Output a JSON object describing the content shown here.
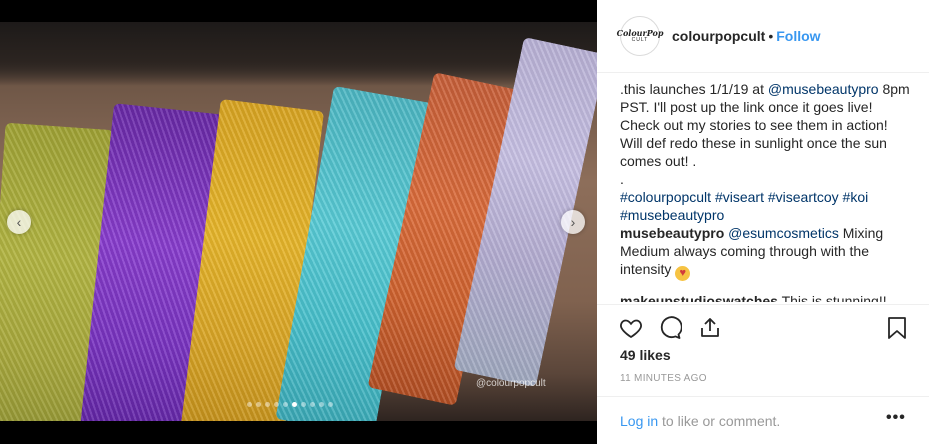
{
  "media": {
    "watermark": "@colourpopcult",
    "nav_prev": "‹",
    "nav_next": "›",
    "dots_total": 10,
    "active_dot": 5
  },
  "header": {
    "avatar_text_top": "ColourPop",
    "avatar_text_bottom": "CULT",
    "username": "colourpopcult",
    "separator": "•",
    "follow_label": "Follow"
  },
  "caption": {
    "text_before_mention": ".this launches 1/1/19 at ",
    "mention": "@musebeautypro",
    "text_after_mention": " 8pm PST. I'll post up the link once it goes live! Check out my stories to see them in action! Will def redo these in sunlight once the sun comes out! .",
    "dot_line": ".",
    "hashtags": "#colourpopcult #viseart #viseartcoy #koi #musebeautypro"
  },
  "comments": [
    {
      "user": "musebeautypro",
      "mention": "@esumcosmetics",
      "text": " Mixing Medium always coming through with the intensity ",
      "emoji": "😍"
    },
    {
      "user": "makeupstudioswatches",
      "text": " This is stunning!!"
    }
  ],
  "actions": {
    "like": "heart-icon",
    "comment": "comment-icon",
    "share": "share-icon",
    "save": "bookmark-icon"
  },
  "likes_text": "49 likes",
  "timestamp": "11 MINUTES AGO",
  "footer": {
    "login_link": "Log in",
    "login_rest": " to like or comment.",
    "more": "•••"
  }
}
